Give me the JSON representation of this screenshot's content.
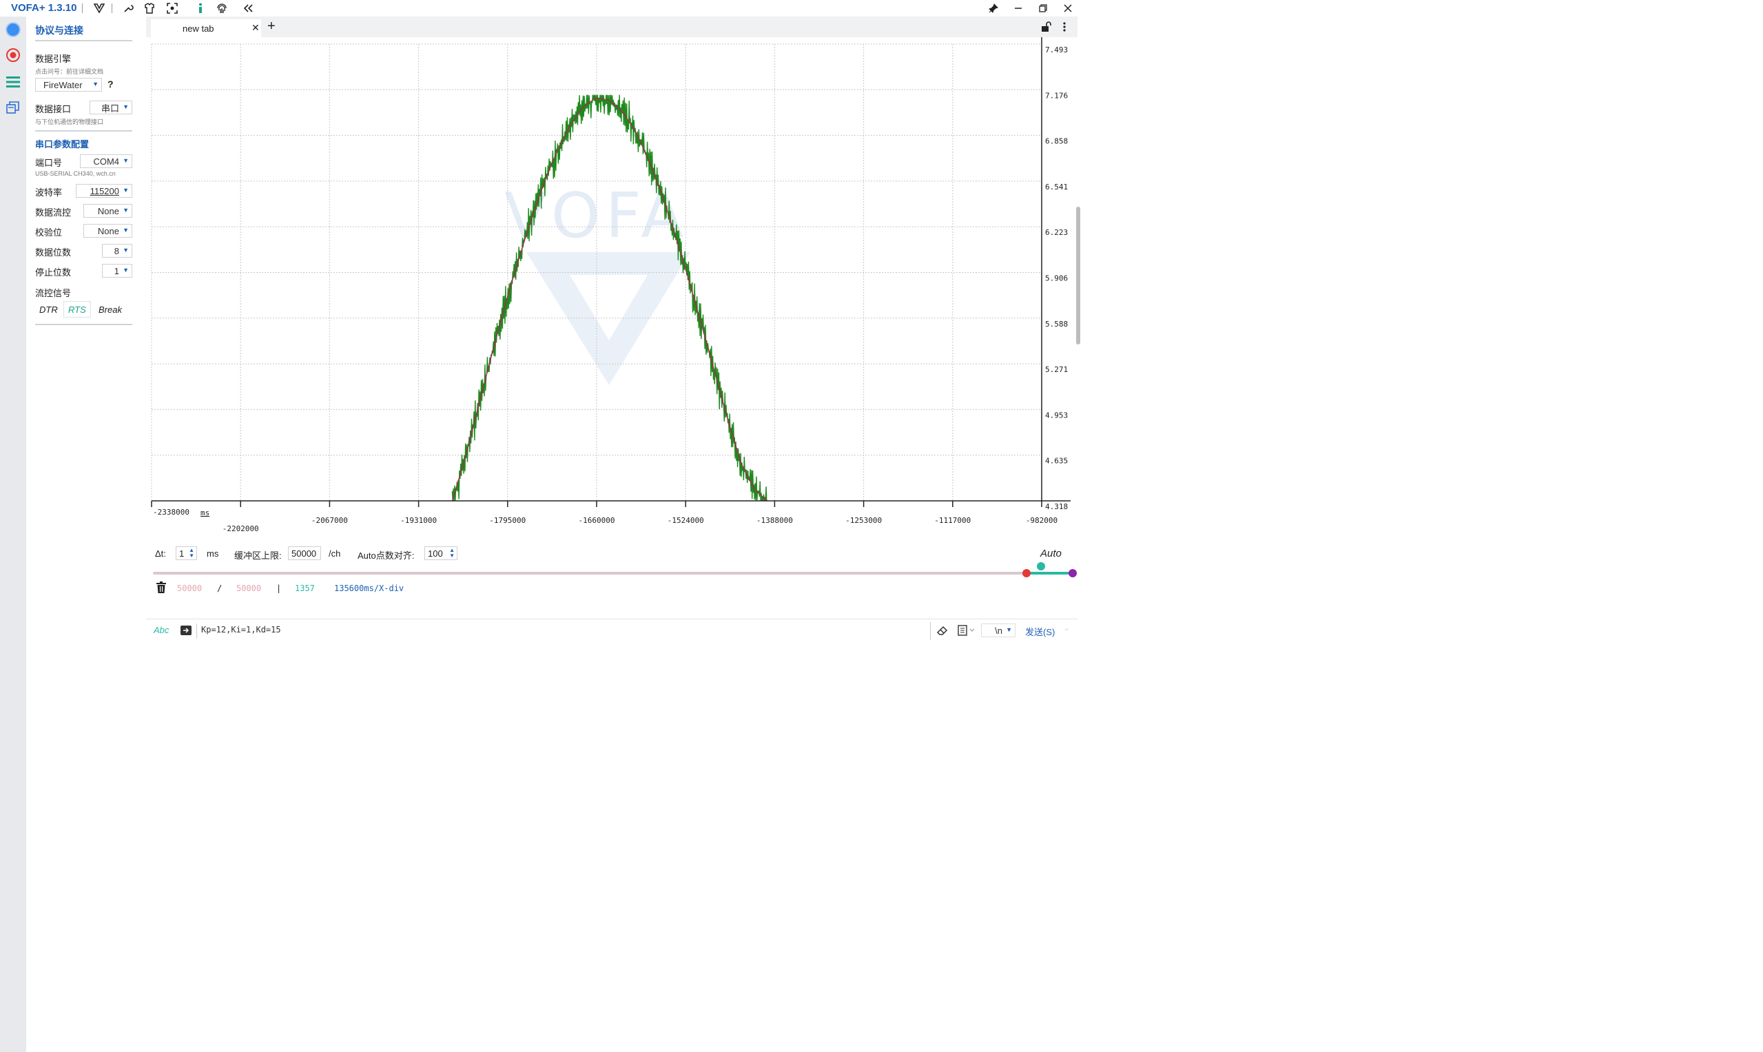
{
  "app": {
    "title": "VOFA+ 1.3.10"
  },
  "window_controls": [
    "pin-icon",
    "minimize-icon",
    "restore-icon",
    "close-icon"
  ],
  "toolbar_icons": [
    "vofa-logo-icon",
    "wrench-icon",
    "shirt-icon",
    "screenshot-icon",
    "info-icon",
    "fingerprint-icon",
    "collapse-icon"
  ],
  "sidebar": {
    "heading": "协议与连接",
    "engine_label": "数据引擎",
    "engine_hint": "点击问号：前往详细文档",
    "engine_value": "FireWater",
    "help": "?",
    "interface_label": "数据接口",
    "interface_value": "串口",
    "interface_hint": "与下位机通信的物理接口",
    "serial_heading": "串口参数配置",
    "port_label": "端口号",
    "port_value": "COM4",
    "port_hint": "USB-SERIAL CH340, wch.cn",
    "baud_label": "波特率",
    "baud_value": "115200",
    "flow_label": "数据流控",
    "flow_value": "None",
    "parity_label": "校验位",
    "parity_value": "None",
    "databits_label": "数据位数",
    "databits_value": "8",
    "stopbits_label": "停止位数",
    "stopbits_value": "1",
    "signal_label": "流控信号",
    "dtr": "DTR",
    "rts": "RTS",
    "brk": "Break"
  },
  "tabs": {
    "active": "new tab",
    "close": "✕",
    "add": "+"
  },
  "chart_data": {
    "type": "line",
    "title": "",
    "xlabel": "",
    "x_unit": "ms",
    "ylabel": "",
    "xlim": [
      -2338000,
      -982000
    ],
    "ylim": [
      4.318,
      7.493
    ],
    "x_ticks": [
      "-2338000",
      "-2202000",
      "-2067000",
      "-1931000",
      "-1795000",
      "-1660000",
      "-1524000",
      "-1388000",
      "-1253000",
      "-1117000",
      "-982000"
    ],
    "y_ticks": [
      "7.493",
      "7.176",
      "6.858",
      "6.541",
      "6.223",
      "5.906",
      "5.588",
      "5.271",
      "4.953",
      "4.635",
      "4.318"
    ],
    "grid": true,
    "watermark": "VOFA",
    "series": [
      {
        "color": "#1e8a1e",
        "style": "noisy",
        "x": [
          -1880000,
          -1860000,
          -1840000,
          -1820000,
          -1800000,
          -1780000,
          -1760000,
          -1740000,
          -1720000,
          -1700000,
          -1680000,
          -1660000,
          -1640000,
          -1620000,
          -1600000,
          -1580000,
          -1560000,
          -1540000,
          -1520000,
          -1500000,
          -1480000,
          -1460000,
          -1440000,
          -1420000,
          -1400000
        ],
        "y": [
          4.318,
          4.62,
          4.98,
          5.33,
          5.67,
          5.98,
          6.27,
          6.53,
          6.75,
          6.93,
          7.06,
          7.12,
          7.1,
          7.02,
          6.88,
          6.68,
          6.44,
          6.16,
          5.86,
          5.54,
          5.21,
          4.88,
          4.58,
          4.4,
          4.318
        ]
      },
      {
        "color": "#c2185b",
        "style": "smooth",
        "x": [
          -1880000,
          -1860000,
          -1840000,
          -1820000,
          -1800000,
          -1780000,
          -1760000,
          -1740000,
          -1720000,
          -1700000,
          -1680000,
          -1660000,
          -1640000,
          -1620000,
          -1600000,
          -1580000,
          -1560000,
          -1540000,
          -1520000,
          -1500000,
          -1480000,
          -1460000,
          -1440000,
          -1420000,
          -1400000
        ],
        "y": [
          4.318,
          4.62,
          4.98,
          5.33,
          5.67,
          5.98,
          6.27,
          6.53,
          6.75,
          6.93,
          7.06,
          7.12,
          7.1,
          7.02,
          6.88,
          6.68,
          6.44,
          6.16,
          5.86,
          5.54,
          5.21,
          4.88,
          4.58,
          4.4,
          4.318
        ]
      }
    ]
  },
  "controls": {
    "dt_label": "Δt:",
    "dt_value": "1",
    "dt_unit": "ms",
    "buffer_label": "缓冲区上限:",
    "buffer_value": "50000",
    "buffer_unit": "/ch",
    "align_label": "Auto点数对齐:",
    "align_value": "100",
    "auto": "Auto",
    "stat_used": "50000",
    "stat_slash": "/",
    "stat_total": "50000",
    "stat_bar": "|",
    "stat_count": "1357",
    "stat_div": "135600ms/X-div"
  },
  "send": {
    "mode": "Abc",
    "text": "Kp=12,Ki=1,Kd=15",
    "newline": "\\n",
    "button": "发送(S)"
  }
}
